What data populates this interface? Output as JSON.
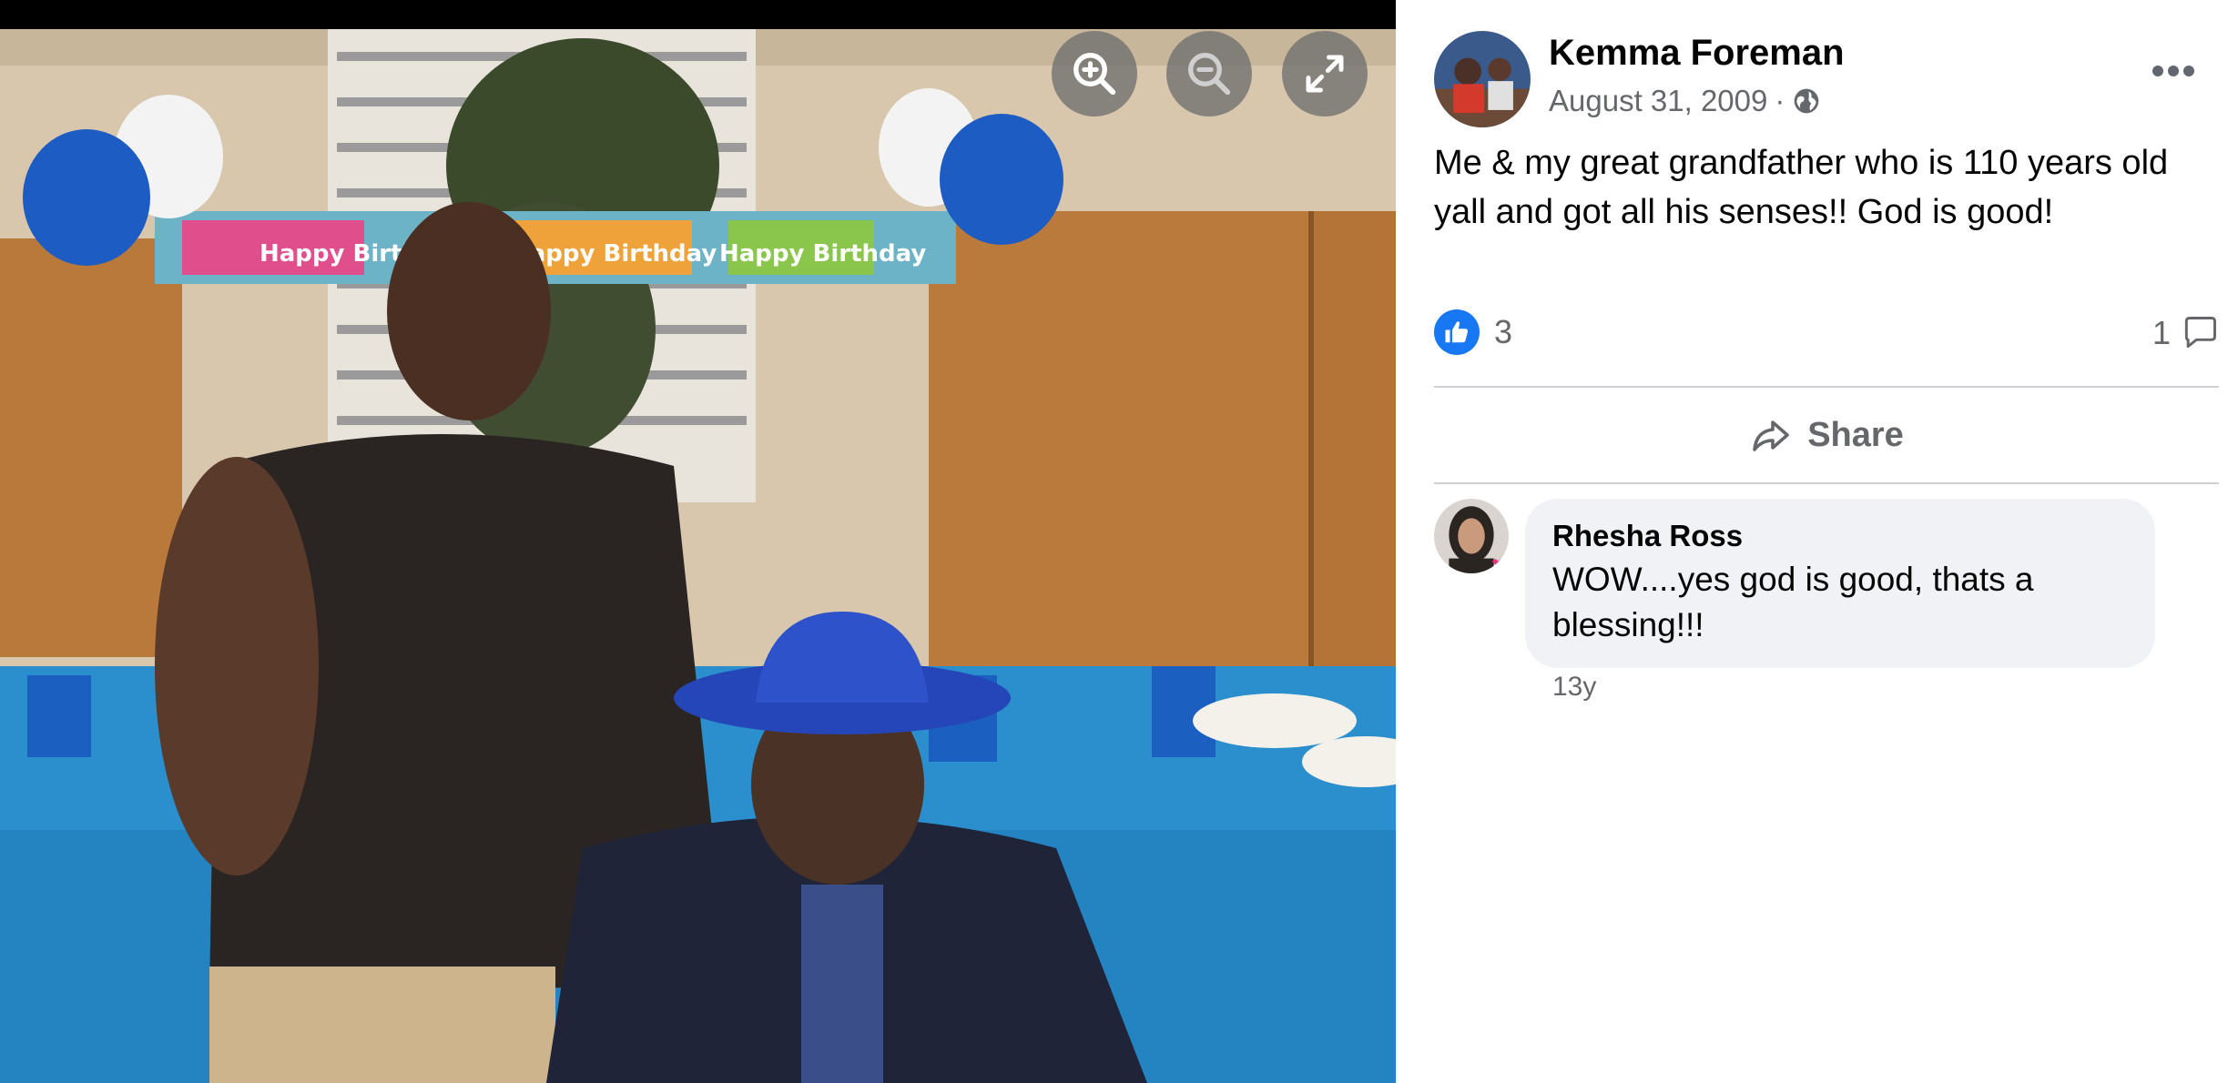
{
  "viewer": {
    "photo_alt": "",
    "banner_text_left": "Happy Birthday",
    "banner_text_mid": "Happy Birthday",
    "banner_text_right": "Happy Birthday",
    "controls": {
      "zoom_in_icon": "zoom-in-icon",
      "zoom_out_icon": "zoom-out-icon",
      "fullscreen_icon": "fullscreen-icon"
    }
  },
  "post": {
    "author": "Kemma Foreman",
    "date": "August 31, 2009",
    "separator": "·",
    "audience_icon": "globe-icon",
    "text": "Me & my great grandfather who is 110 years old yall and got all his senses!! God is good!",
    "reaction_count": "3",
    "comment_count": "1",
    "share_label": "Share"
  },
  "comments": [
    {
      "author": "Rhesha Ross",
      "text": "WOW....yes god is good, thats a blessing!!!",
      "age": "13y"
    }
  ],
  "colors": {
    "like_blue": "#1877f2",
    "secondary_text": "#65676b",
    "bubble_bg": "#f0f2f5",
    "divider": "#ced0d4"
  }
}
